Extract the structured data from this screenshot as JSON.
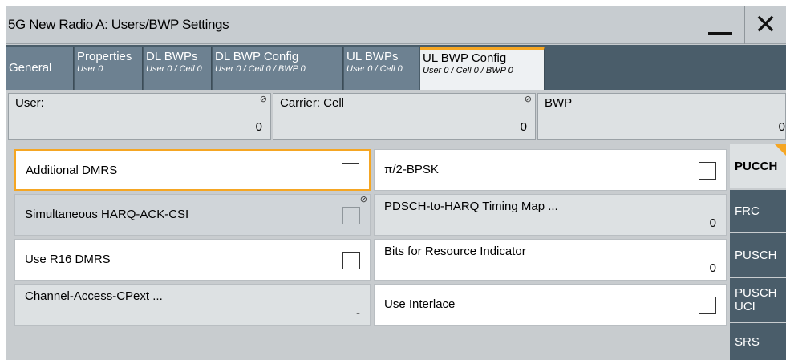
{
  "window": {
    "title": "5G New Radio A: Users/BWP Settings"
  },
  "titlebar": {
    "minimize_icon": "minimize-icon",
    "close_icon": "close-icon"
  },
  "tabs": [
    {
      "label": "General",
      "sub": ""
    },
    {
      "label": "Properties",
      "sub": "User 0"
    },
    {
      "label": "DL BWPs",
      "sub": "User 0 / Cell 0"
    },
    {
      "label": "DL BWP Config",
      "sub": "User 0 / Cell 0 / BWP 0"
    },
    {
      "label": "UL BWPs",
      "sub": "User 0 / Cell 0"
    },
    {
      "label": "UL BWP Config",
      "sub": "User 0 / Cell 0 / BWP 0",
      "active": true
    }
  ],
  "info": {
    "user": {
      "label": "User:",
      "value": "0"
    },
    "carrier": {
      "label": "Carrier: Cell",
      "value": "0"
    },
    "bwp": {
      "label": "BWP",
      "value": "0"
    }
  },
  "fields": {
    "additional_dmrs": {
      "label": "Additional DMRS",
      "checked": false
    },
    "pi2_bpsk": {
      "label": "π/2-BPSK",
      "checked": false
    },
    "simultaneous_harq": {
      "label": "Simultaneous HARQ-ACK-CSI",
      "checked": false
    },
    "pdsch_harq_map": {
      "label": "PDSCH-to-HARQ Timing Map ...",
      "value": "0"
    },
    "use_r16_dmrs": {
      "label": "Use R16 DMRS",
      "checked": false
    },
    "bits_resource": {
      "label": "Bits for Resource Indicator",
      "value": "0"
    },
    "channel_access": {
      "label": "Channel-Access-CPext ...",
      "value": "-"
    },
    "use_interlace": {
      "label": "Use Interlace",
      "checked": false
    }
  },
  "sidetabs": [
    {
      "label": "PUCCH",
      "active": true
    },
    {
      "label": "FRC"
    },
    {
      "label": "PUSCH"
    },
    {
      "label": "PUSCH UCI"
    },
    {
      "label": "SRS"
    }
  ],
  "colors": {
    "accent": "#f5a623",
    "tab_bg": "#6d8191",
    "dark_bg": "#4a5d6a"
  }
}
